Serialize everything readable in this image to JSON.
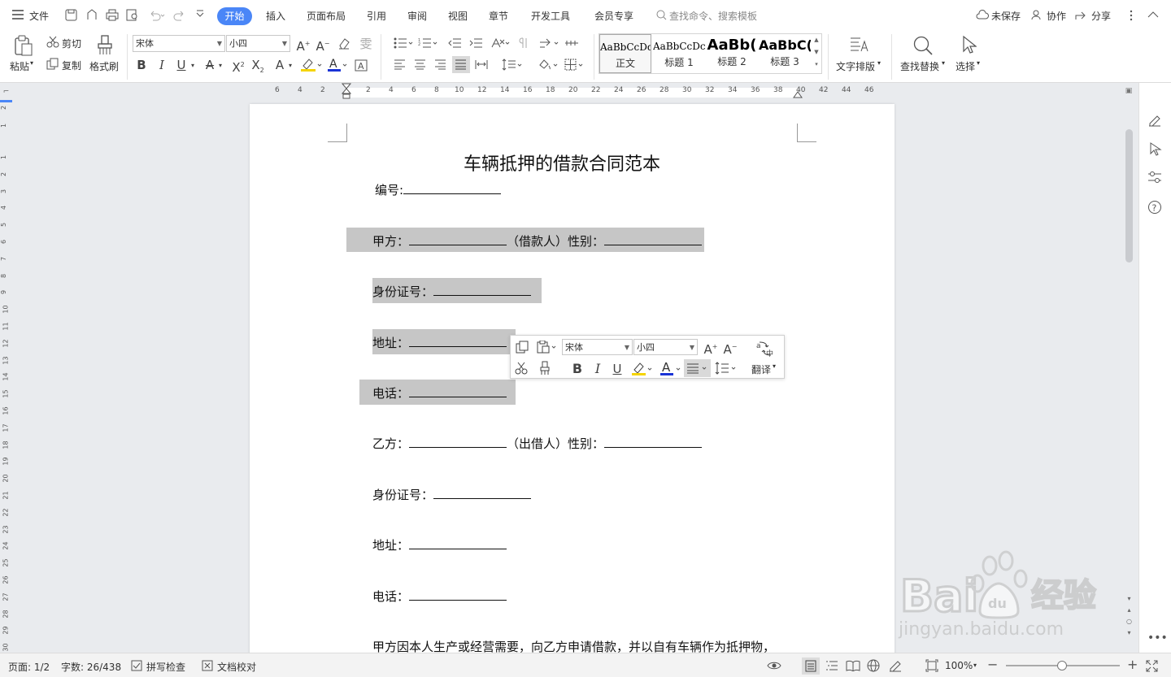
{
  "menubar": {
    "file_label": "文件",
    "tabs": [
      "开始",
      "插入",
      "页面布局",
      "引用",
      "审阅",
      "视图",
      "章节",
      "开发工具",
      "会员专享"
    ],
    "search_placeholder": "查找命令、搜索模板",
    "unsaved_label": "未保存",
    "collab_label": "协作",
    "share_label": "分享"
  },
  "ribbon": {
    "paste_label": "粘贴",
    "cut_label": "剪切",
    "copy_label": "复制",
    "format_painter_label": "格式刷",
    "font_name": "宋体",
    "font_size": "小四",
    "styles": [
      {
        "preview": "AaBbCcDd",
        "name": "正文"
      },
      {
        "preview": "AaBbCcDc",
        "name": "标题 1"
      },
      {
        "preview": "AaBb(",
        "name": "标题 2"
      },
      {
        "preview": "AaBbC(",
        "name": "标题 3"
      }
    ],
    "text_layout_label": "文字排版",
    "find_replace_label": "查找替换",
    "select_label": "选择"
  },
  "ruler": {
    "h_ticks": [
      "6",
      "4",
      "2",
      "2",
      "4",
      "6",
      "8",
      "10",
      "12",
      "14",
      "16",
      "18",
      "20",
      "22",
      "24",
      "26",
      "28",
      "30",
      "32",
      "34",
      "36",
      "38",
      "40",
      "42",
      "44",
      "46"
    ],
    "v_ticks": [
      "2",
      "1",
      "1",
      "2",
      "3",
      "4",
      "5",
      "6",
      "7",
      "8",
      "9",
      "10",
      "11",
      "12",
      "13",
      "14",
      "15",
      "16",
      "17",
      "18",
      "19",
      "20",
      "21",
      "22",
      "23",
      "24",
      "25",
      "26",
      "27",
      "28",
      "29",
      "30"
    ]
  },
  "document": {
    "title": "车辆抵押的借款合同范本",
    "number_label": "编号:",
    "party_a_label": "甲方：",
    "borrower_label": "（借款人）性别：",
    "id_label": "身份证号：",
    "address_label": "地址：",
    "phone_label": "电话：",
    "party_b_label": "乙方：",
    "lender_label": "（出借人）性别：",
    "body_text": "甲方因本人生产或经营需要，向乙方申请借款，并以自有车辆作为抵押物，"
  },
  "mini_toolbar": {
    "font_name": "宋体",
    "font_size": "小四",
    "translate_label": "翻译"
  },
  "status": {
    "page": "页面: 1/2",
    "word_count": "字数: 26/438",
    "spell_check": "拼写检查",
    "doc_proof": "文档校对",
    "zoom": "100%"
  },
  "watermark": {
    "text": "经验",
    "url": "jingyan.baidu.com"
  },
  "colors": {
    "accent": "#4a86f7",
    "highlight_yellow": "#f5d400",
    "font_color_red": "#e02020",
    "font_color_blue": "#1a33d6",
    "selection": "#c6c6c6"
  }
}
